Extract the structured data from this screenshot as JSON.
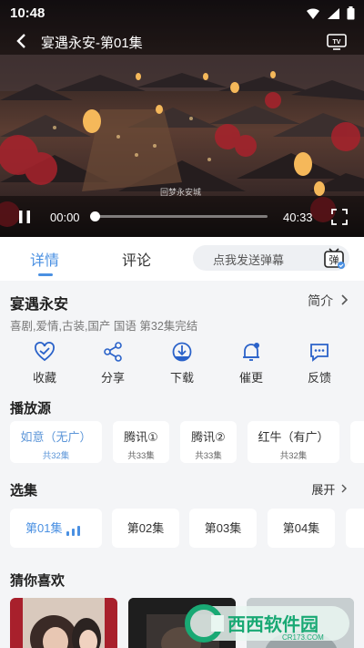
{
  "status": {
    "time": "10:48"
  },
  "player": {
    "title": "宴遇永安-第01集",
    "watermark": "回梦永安城",
    "current_time": "00:00",
    "total_time": "40:33",
    "progress_fraction": 0.0,
    "icons": [
      "back-arrow-icon",
      "tv-cast-icon",
      "pause-icon",
      "fullscreen-icon"
    ]
  },
  "tabs": [
    {
      "label": "详情",
      "active": true
    },
    {
      "label": "评论",
      "active": false
    }
  ],
  "danmu": {
    "placeholder": "点我发送弹幕",
    "icon_label": "弹"
  },
  "show": {
    "title": "宴遇永安",
    "intro_label": "简介",
    "meta": "喜剧,爱情,古装,国产 国语 第32集完结"
  },
  "actions": [
    {
      "label": "收藏",
      "icon": "heart-icon"
    },
    {
      "label": "分享",
      "icon": "share-icon"
    },
    {
      "label": "下载",
      "icon": "download-icon"
    },
    {
      "label": "催更",
      "icon": "bell-icon"
    },
    {
      "label": "反馈",
      "icon": "feedback-icon"
    }
  ],
  "sources_title": "播放源",
  "sources": [
    {
      "name": "如意（无广）",
      "count": "共32集",
      "active": true
    },
    {
      "name": "腾讯①",
      "count": "共33集",
      "active": false
    },
    {
      "name": "腾讯②",
      "count": "共33集",
      "active": false
    },
    {
      "name": "红牛（有广）",
      "count": "共32集",
      "active": false
    }
  ],
  "episodes_title": "选集",
  "expand_label": "展开",
  "episodes": [
    {
      "label": "第01集",
      "active": true
    },
    {
      "label": "第02集",
      "active": false
    },
    {
      "label": "第03集",
      "active": false
    },
    {
      "label": "第04集",
      "active": false
    }
  ],
  "recommend_title": "猜你喜欢",
  "site_badge": {
    "domain": "CR173.COM"
  },
  "colors": {
    "accent": "#4a90e2",
    "background": "#f4f5f7"
  }
}
